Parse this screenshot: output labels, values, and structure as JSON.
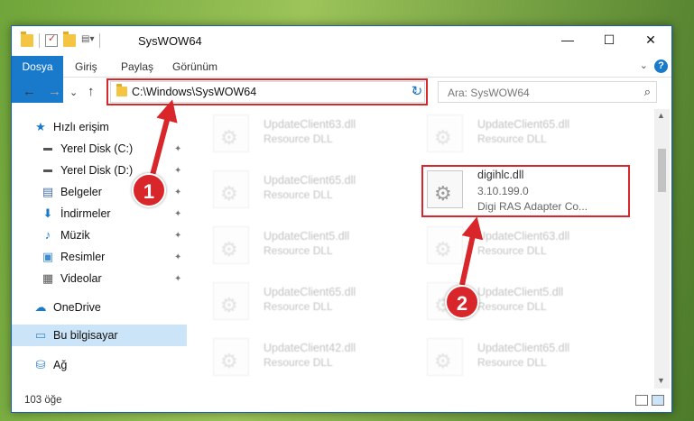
{
  "window": {
    "title": "SysWOW64",
    "controls": {
      "minimize": "—",
      "maximize": "☐",
      "close": "✕"
    }
  },
  "ribbon": {
    "tabs": [
      "Dosya",
      "Giriş",
      "Paylaş",
      "Görünüm"
    ],
    "help": "?",
    "collapse": "⌄"
  },
  "nav": {
    "back": "←",
    "forward": "→",
    "recent": "⌄",
    "up": "↑"
  },
  "address": {
    "path": "C:\\Windows\\SysWOW64",
    "dropdown": "⌄",
    "refresh": "↻"
  },
  "search": {
    "placeholder": "Ara: SysWOW64",
    "icon": "⌕"
  },
  "sidebar": {
    "items": [
      {
        "label": "Hızlı erişim",
        "icon": "★",
        "pinned": false
      },
      {
        "label": "Yerel Disk (C:)",
        "icon": "▬",
        "pinned": true
      },
      {
        "label": "Yerel Disk (D:)",
        "icon": "▬",
        "pinned": true
      },
      {
        "label": "Belgeler",
        "icon": "▤",
        "pinned": true
      },
      {
        "label": "İndirmeler",
        "icon": "⬇",
        "pinned": true
      },
      {
        "label": "Müzik",
        "icon": "♪",
        "pinned": true
      },
      {
        "label": "Resimler",
        "icon": "▣",
        "pinned": true
      },
      {
        "label": "Videolar",
        "icon": "▦",
        "pinned": true
      },
      {
        "label": "OneDrive",
        "icon": "☁",
        "pinned": false
      },
      {
        "label": "Bu bilgisayar",
        "icon": "▭",
        "pinned": false
      },
      {
        "label": "Ağ",
        "icon": "⛁",
        "pinned": false
      }
    ],
    "pin_icon": "📌"
  },
  "files": [
    {
      "name": "UpdateClient63.dll",
      "desc": "Resource DLL"
    },
    {
      "name": "UpdateClient65.dll",
      "desc": "Resource DLL"
    },
    {
      "name": "UpdateClient65.dll",
      "desc": "Resource DLL"
    },
    {
      "name": "digihlc.dll",
      "version": "3.10.199.0",
      "desc": "Digi RAS Adapter Co..."
    },
    {
      "name": "UpdateClient5.dll",
      "desc": "Resource DLL"
    },
    {
      "name": "UpdateClient63.dll",
      "desc": "Resource DLL"
    },
    {
      "name": "UpdateClient65.dll",
      "desc": "Resource DLL"
    },
    {
      "name": "UpdateClient5.dll",
      "desc": "Resource DLL"
    },
    {
      "name": "UpdateClient42.dll",
      "desc": "Resource DLL"
    },
    {
      "name": "UpdateClient65.dll",
      "desc": "Resource DLL"
    }
  ],
  "status": {
    "count": "103 öğe"
  },
  "annotations": {
    "badge1": "1",
    "badge2": "2"
  },
  "colors": {
    "accent": "#1979ca",
    "highlight": "#d9262b",
    "selected": "#cce4f7"
  }
}
